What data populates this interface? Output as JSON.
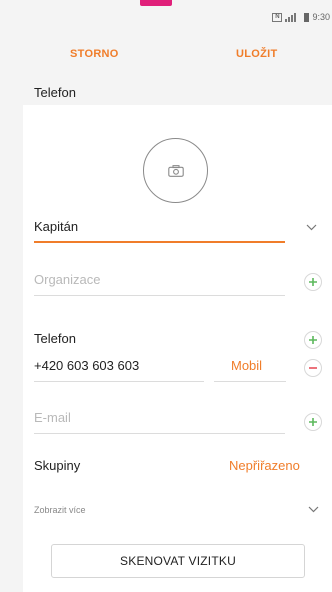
{
  "status_bar": {
    "time": "9:30",
    "nfc": "N"
  },
  "action_bar": {
    "cancel_label": "STORNO",
    "save_label": "ULOŽIT"
  },
  "account_label": "Telefon",
  "name": {
    "value": "Kapitán"
  },
  "organization": {
    "placeholder": "Organizace"
  },
  "phone": {
    "label": "Telefon",
    "number": "+420 603 603 603",
    "type": "Mobil"
  },
  "email": {
    "placeholder": "E-mail"
  },
  "groups": {
    "label": "Skupiny",
    "value": "Nepřiřazeno"
  },
  "show_more": {
    "label": "Zobrazit více"
  },
  "scan_button": {
    "label": "SKENOVAT VIZITKU"
  },
  "colors": {
    "accent": "#f07d2a",
    "add": "#5cb85c",
    "remove": "#e8505b",
    "brand_tab": "#e0207a"
  },
  "icons": [
    "camera-icon",
    "chevron-down-icon",
    "plus-icon",
    "minus-icon"
  ]
}
